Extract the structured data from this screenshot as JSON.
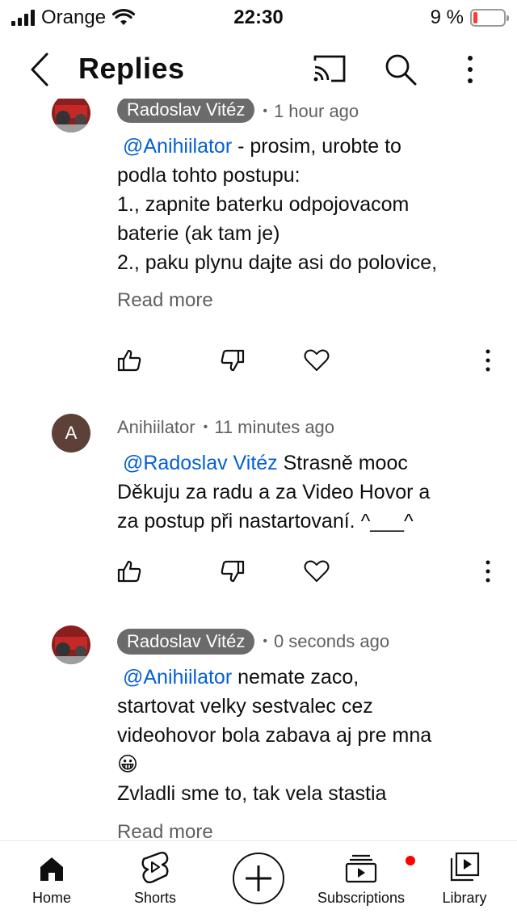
{
  "status_bar": {
    "carrier": "Orange",
    "time": "22:30",
    "battery": "9 %"
  },
  "header": {
    "title": "Replies"
  },
  "comments": [
    {
      "author": "Radoslav Vitéz",
      "time": "1 hour ago",
      "mention": "@Anihiilator",
      "lines": [
        " - prosim, urobte to",
        "podla tohto postupu:",
        "1., zapnite baterku odpojovacom",
        "baterie (ak tam je)",
        "2., paku plynu dajte asi do polovice,"
      ],
      "read_more": "Read more"
    },
    {
      "author": "Anihiilator",
      "avatar_letter": "A",
      "time": "11 minutes ago",
      "mention": "@Radoslav Vitéz",
      "lines": [
        " Strasně mooc",
        "Děkuju za radu a za Video Hovor a",
        "za postup při nastartovaní. ^___^"
      ]
    },
    {
      "author": "Radoslav Vitéz",
      "time": "0 seconds ago",
      "mention": "@Anihiilator",
      "lines": [
        " nemate zaco,",
        "startovat velky sestvalec cez",
        "videohovor bola zabava aj pre mna",
        "😀",
        "Zvladli sme to, tak vela stastia"
      ],
      "read_more": "Read more"
    }
  ],
  "nav": {
    "home": "Home",
    "shorts": "Shorts",
    "subscriptions": "Subscriptions",
    "library": "Library"
  },
  "colors": {
    "mention": "#065fd4",
    "author_chip": "#6b6b6b",
    "notification_dot": "#ff0000",
    "battery_low": "#ff3b30"
  },
  "icons": [
    "back-icon",
    "cast-icon",
    "search-icon",
    "more-vert-icon",
    "thumb-up-icon",
    "thumb-down-icon",
    "heart-icon",
    "home-icon",
    "shorts-icon",
    "create-icon",
    "subscriptions-icon",
    "library-icon"
  ]
}
